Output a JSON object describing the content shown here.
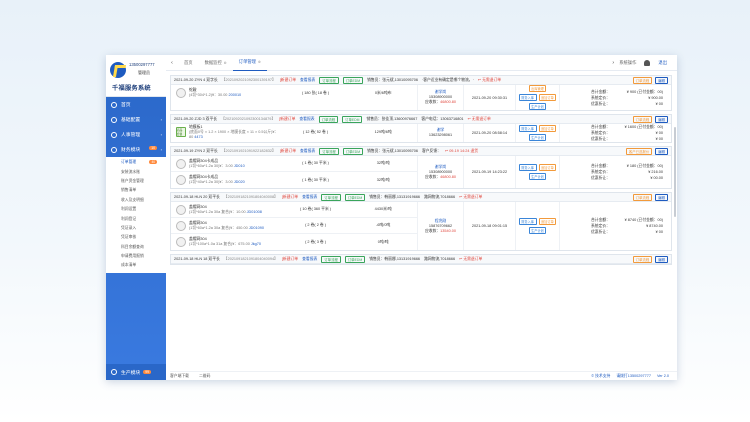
{
  "brand": {
    "phone": "13500297777",
    "role": "管理员",
    "system_name": "千福服务系统"
  },
  "sidebar": {
    "items": [
      {
        "label": "首页",
        "icon": "home-icon"
      },
      {
        "label": "基础配置",
        "icon": "config-icon"
      },
      {
        "label": "人事管理",
        "icon": "user-icon"
      },
      {
        "label": "财务模块",
        "icon": "finance-icon",
        "badge": "10"
      }
    ],
    "subitems": [
      {
        "label": "订单管理",
        "badge": "40",
        "active": true
      },
      {
        "label": "安装流水账"
      },
      {
        "label": "账户资金管理"
      },
      {
        "label": "销售清单"
      },
      {
        "label": "收入及支明细"
      },
      {
        "label": "利润设置"
      },
      {
        "label": "利润登记"
      },
      {
        "label": "凭证录入"
      },
      {
        "label": "凭证审核"
      },
      {
        "label": "科目余额查询"
      },
      {
        "label": "申请费用报销"
      },
      {
        "label": "成本清单"
      }
    ],
    "bottom": {
      "label": "生产模块",
      "badge": "99"
    }
  },
  "topbar": {
    "tabs": [
      {
        "label": "首页",
        "active": false,
        "closable": false
      },
      {
        "label": "数据监控",
        "active": false,
        "closable": true
      },
      {
        "label": "订单管理",
        "active": true,
        "closable": true
      }
    ],
    "system_menu": "系统操作",
    "logout": "退出"
  },
  "orders": [
    {
      "no": "2021-09-20 ZYN 4 双字长",
      "code": "【2021092021092300139197】",
      "tag_red": "[新建订单",
      "tag_blue": "查看报表",
      "btns": [
        "订单流程",
        "订单EDM"
      ],
      "seller": "销售员：张元斌,13010095706",
      "note": "·客户近业有确定是哪个物流，·",
      "refund": "无需退订单",
      "head_right": [
        "订单流程",
        "编辑"
      ],
      "items": [
        {
          "name": "蛇鞍",
          "spec": "(4切*304*1.2)¥：",
          "price": "30.00",
          "link": "200010",
          "qty": "( 180 张( 18 卷 )",
          "unit": "0米/6吨布"
        }
      ],
      "customer": {
        "name": "谢学岗",
        "phone": "15308900000",
        "label": "应收款：",
        "amount": "46800.80"
      },
      "time": "2021-09-20 09:30:31",
      "ops": [
        [
          "出库管理"
        ],
        [
          "财务入库",
          "追加订单"
        ],
        [
          "生产计划"
        ]
      ],
      "amount": {
        "total_label": "合计金额：",
        "total": "¥ 900 (已付金额：00)",
        "sys_label": "系统定价：",
        "sys": "¥ 900.00",
        "discount_label": "优惠折让：",
        "discount": "¥ 00"
      }
    },
    {
      "no": "2021-09-20 ZJD 3 双平长",
      "code": "【2021092021092300134879】",
      "tag_red": "[新建订单",
      "tag_blue": "查看报表",
      "btns": [
        "订单流程",
        "订单EDM"
      ],
      "seller": "销售员：张佳顶,13600976667",
      "note": "客户电话：13063716801",
      "refund": "无需退订单",
      "head_right": [
        "订单流程",
        "编辑"
      ],
      "items": [
        {
          "tag": "商品·套餐",
          "name": "地膜板1",
          "spec": "(底面0号 × 1.2 × 1900 × 地膜长度 × 11 × 0.5公斤)¥：",
          "price": "80",
          "link": "4473",
          "qty": "( 12 卷( 52 卷 )",
          "unit": "129吨/6吨"
        }
      ],
      "customer": {
        "name": "谢学",
        "phone": "13623298061",
        "label": "",
        "amount": ""
      },
      "time": "2021-09-20 08:58:14",
      "ops": [
        [
          "财务入库",
          "追加订单"
        ],
        [
          "生产计划"
        ]
      ],
      "amount": {
        "total_label": "合计金额：",
        "total": "¥ 1600 (已付金额：00)",
        "sys_label": "系统定价：",
        "sys": "¥ 00",
        "discount_label": "优惠折让：",
        "discount": "¥ 00"
      }
    },
    {
      "no": "2021-09-19 ZYN 2 双平长",
      "code": "【2021091921091922182832】",
      "tag_red": "[新建订单",
      "tag_blue": "查看报表",
      "btns": [
        "订单流程",
        "订单EDM"
      ],
      "seller": "销售员：张元斌,13010095706",
      "note": "客户反馈：",
      "refund": "09-19 14:24 退货",
      "head_right": [
        "客户已选报价",
        "编辑"
      ],
      "items": [
        {
          "name": "盖帽网304卡成品",
          "spec": "(1切*60a*1.2a 30)¥：",
          "price": "3.00",
          "link": "JD010",
          "qty": "( 1 卷( 30 平米 )",
          "unit": "32吨/吨"
        },
        {
          "name": "盖帽网304卡成品",
          "spec": "(1切*40a*1.2a 30)¥：",
          "price": "3.00",
          "link": "JD020",
          "qty": "( 1 卷( 30 平米 )",
          "unit": "32吨/吨"
        }
      ],
      "customer": {
        "name": "谢学岗",
        "phone": "15308900000",
        "label": "应收款：",
        "amount": "46800.80"
      },
      "time": "2021-09-19 14:23:22",
      "ops": [
        [
          "财务入库",
          "追加订单"
        ],
        [
          "生产计划"
        ]
      ],
      "amount": {
        "total_label": "合计金额：",
        "total": "¥ 180 (已付金额：00)",
        "sys_label": "系统定价：",
        "sys": "¥ 216.00",
        "discount_label": "优惠折让：",
        "discount": "¥ 00.00"
      }
    },
    {
      "no": "2021-09-18 HLN 20 双平长",
      "code": "【2021091821091804040008】",
      "tag_red": "[新建订单",
      "tag_blue": "查看报表",
      "btns": [
        "订单流程",
        "订单EDM"
      ],
      "seller": "销售员：韩丽娜,13131919666",
      "note": "路网物流,7018666",
      "refund": "无需退订单",
      "head_right": [
        "订单流程",
        "编辑"
      ],
      "items": [
        {
          "name": "盖帽网304",
          "spec": "(1切*60a*1.2a 30a 复合)¥：",
          "price": "10.00",
          "link": "JD01008",
          "qty": "( 10 卷( 360 平米 )",
          "unit": "4430米/吨"
        },
        {
          "name": "盖帽网304",
          "spec": "(1切*60a*1.2a 30a 复合)¥：",
          "price": "450.00",
          "link": "JD01090",
          "qty": "( 2 卷( 2 卷 )",
          "unit": "-6吨/0吨"
        },
        {
          "name": "盖帽网304",
          "spec": "(1切*100a*1.0a 31a 复合)¥：",
          "price": "675.00",
          "link": "Jkg70",
          "qty": "( 2 卷( 3 卷 )",
          "unit": "0吨/吨"
        }
      ],
      "customer": {
        "name": "程兆刚",
        "phone": "15876709662",
        "label": "应收款：",
        "amount": "13540.00"
      },
      "time": "2021-09-18 09:01:15",
      "ops": [
        [
          "财务入库",
          "追加订单"
        ],
        [
          "生产计划"
        ]
      ],
      "amount": {
        "total_label": "合计金额：",
        "total": "¥ 8740 (已付金额：00)",
        "sys_label": "系统定价：",
        "sys": "¥ 8740.00",
        "discount_label": "优惠折让：",
        "discount": "¥ 00"
      }
    },
    {
      "no": "2021-09-18 HLN 18 双平长",
      "code": "【2021091821091804040094】",
      "tag_red": "[新建订单",
      "tag_blue": "查看报表",
      "btns": [
        "订单流程",
        "订单EDM"
      ],
      "seller": "销售员：韩丽娜,13131919666",
      "note": "路网物流,7018666",
      "refund": "无需退订单",
      "head_right": [
        "订单流程",
        "编辑"
      ],
      "items": [],
      "customer": {
        "name": "",
        "phone": "",
        "label": "",
        "amount": ""
      },
      "time": "",
      "ops": [],
      "amount": {
        "total_label": "",
        "total": "",
        "sys_label": "",
        "sys": "",
        "discount_label": "",
        "discount": ""
      }
    }
  ],
  "footer": {
    "left1": "客户端下载",
    "left2": "二维码",
    "right1": "© 技术支持",
    "right2": "请拨打13500297777",
    "right3": "Ver 2.0"
  }
}
